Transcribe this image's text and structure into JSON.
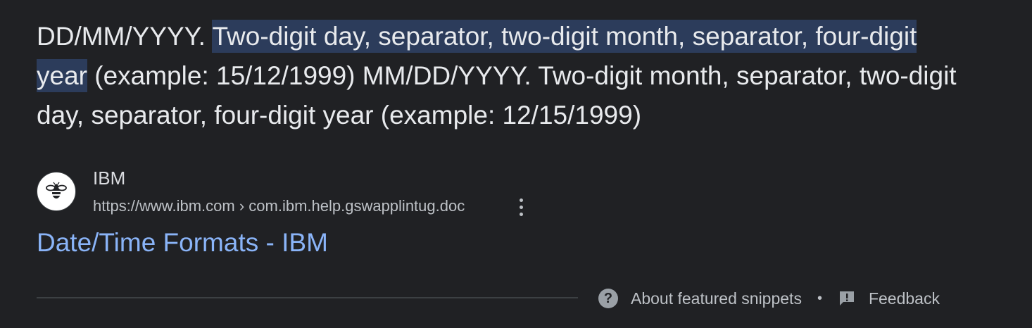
{
  "snippet": {
    "lead": "DD/MM/YYYY. ",
    "highlight": "Two-digit day, separator, two-digit month, separator, four-digit year",
    "rest": " (example: 15/12/1999) MM/DD/YYYY. Two-digit month, separator, two-digit day, separator, four-digit year (example: 12/15/1999)"
  },
  "source": {
    "site_name": "IBM",
    "url": "https://www.ibm.com › com.ibm.help.gswapplintug.doc",
    "favicon_icon": "ibm-bee-icon",
    "more_icon": "more-vert-icon"
  },
  "result": {
    "title": "Date/Time Formats - IBM"
  },
  "footer": {
    "about_label": "About featured snippets",
    "separator": "•",
    "feedback_label": "Feedback",
    "help_icon": "help-circle-icon",
    "feedback_icon": "feedback-icon"
  },
  "colors": {
    "background": "#202124",
    "text": "#e8eaed",
    "highlight_bg": "#2c3c5b",
    "link": "#8ab4f8",
    "muted": "#bdc1c6"
  }
}
